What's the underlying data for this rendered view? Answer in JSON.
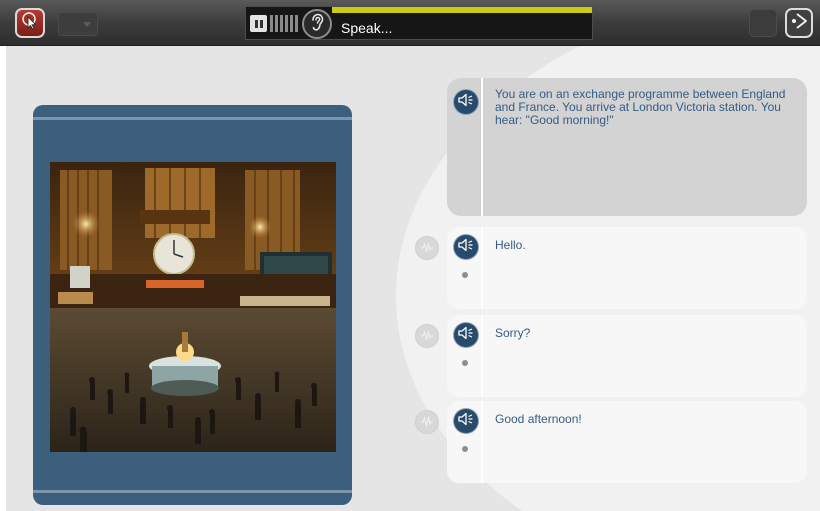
{
  "toolbar": {
    "speak_label": "Speak...",
    "recording_progress": 1.0,
    "progress_color": "#c9cc10",
    "icons": [
      "pointer-icon",
      "pause-icon",
      "ear-icon",
      "next-icon"
    ]
  },
  "prompt": {
    "text": "You are on an exchange programme between England and France. You arrive at London Victoria station. You hear: \"Good morning!\""
  },
  "options": [
    {
      "label": "Hello."
    },
    {
      "label": "Sorry?"
    },
    {
      "label": "Good afternoon!"
    }
  ],
  "colors": {
    "accent_blue": "#284a6c",
    "text_blue": "#345b84",
    "media_panel": "#3c5f7e",
    "record_red": "#b33b33"
  }
}
